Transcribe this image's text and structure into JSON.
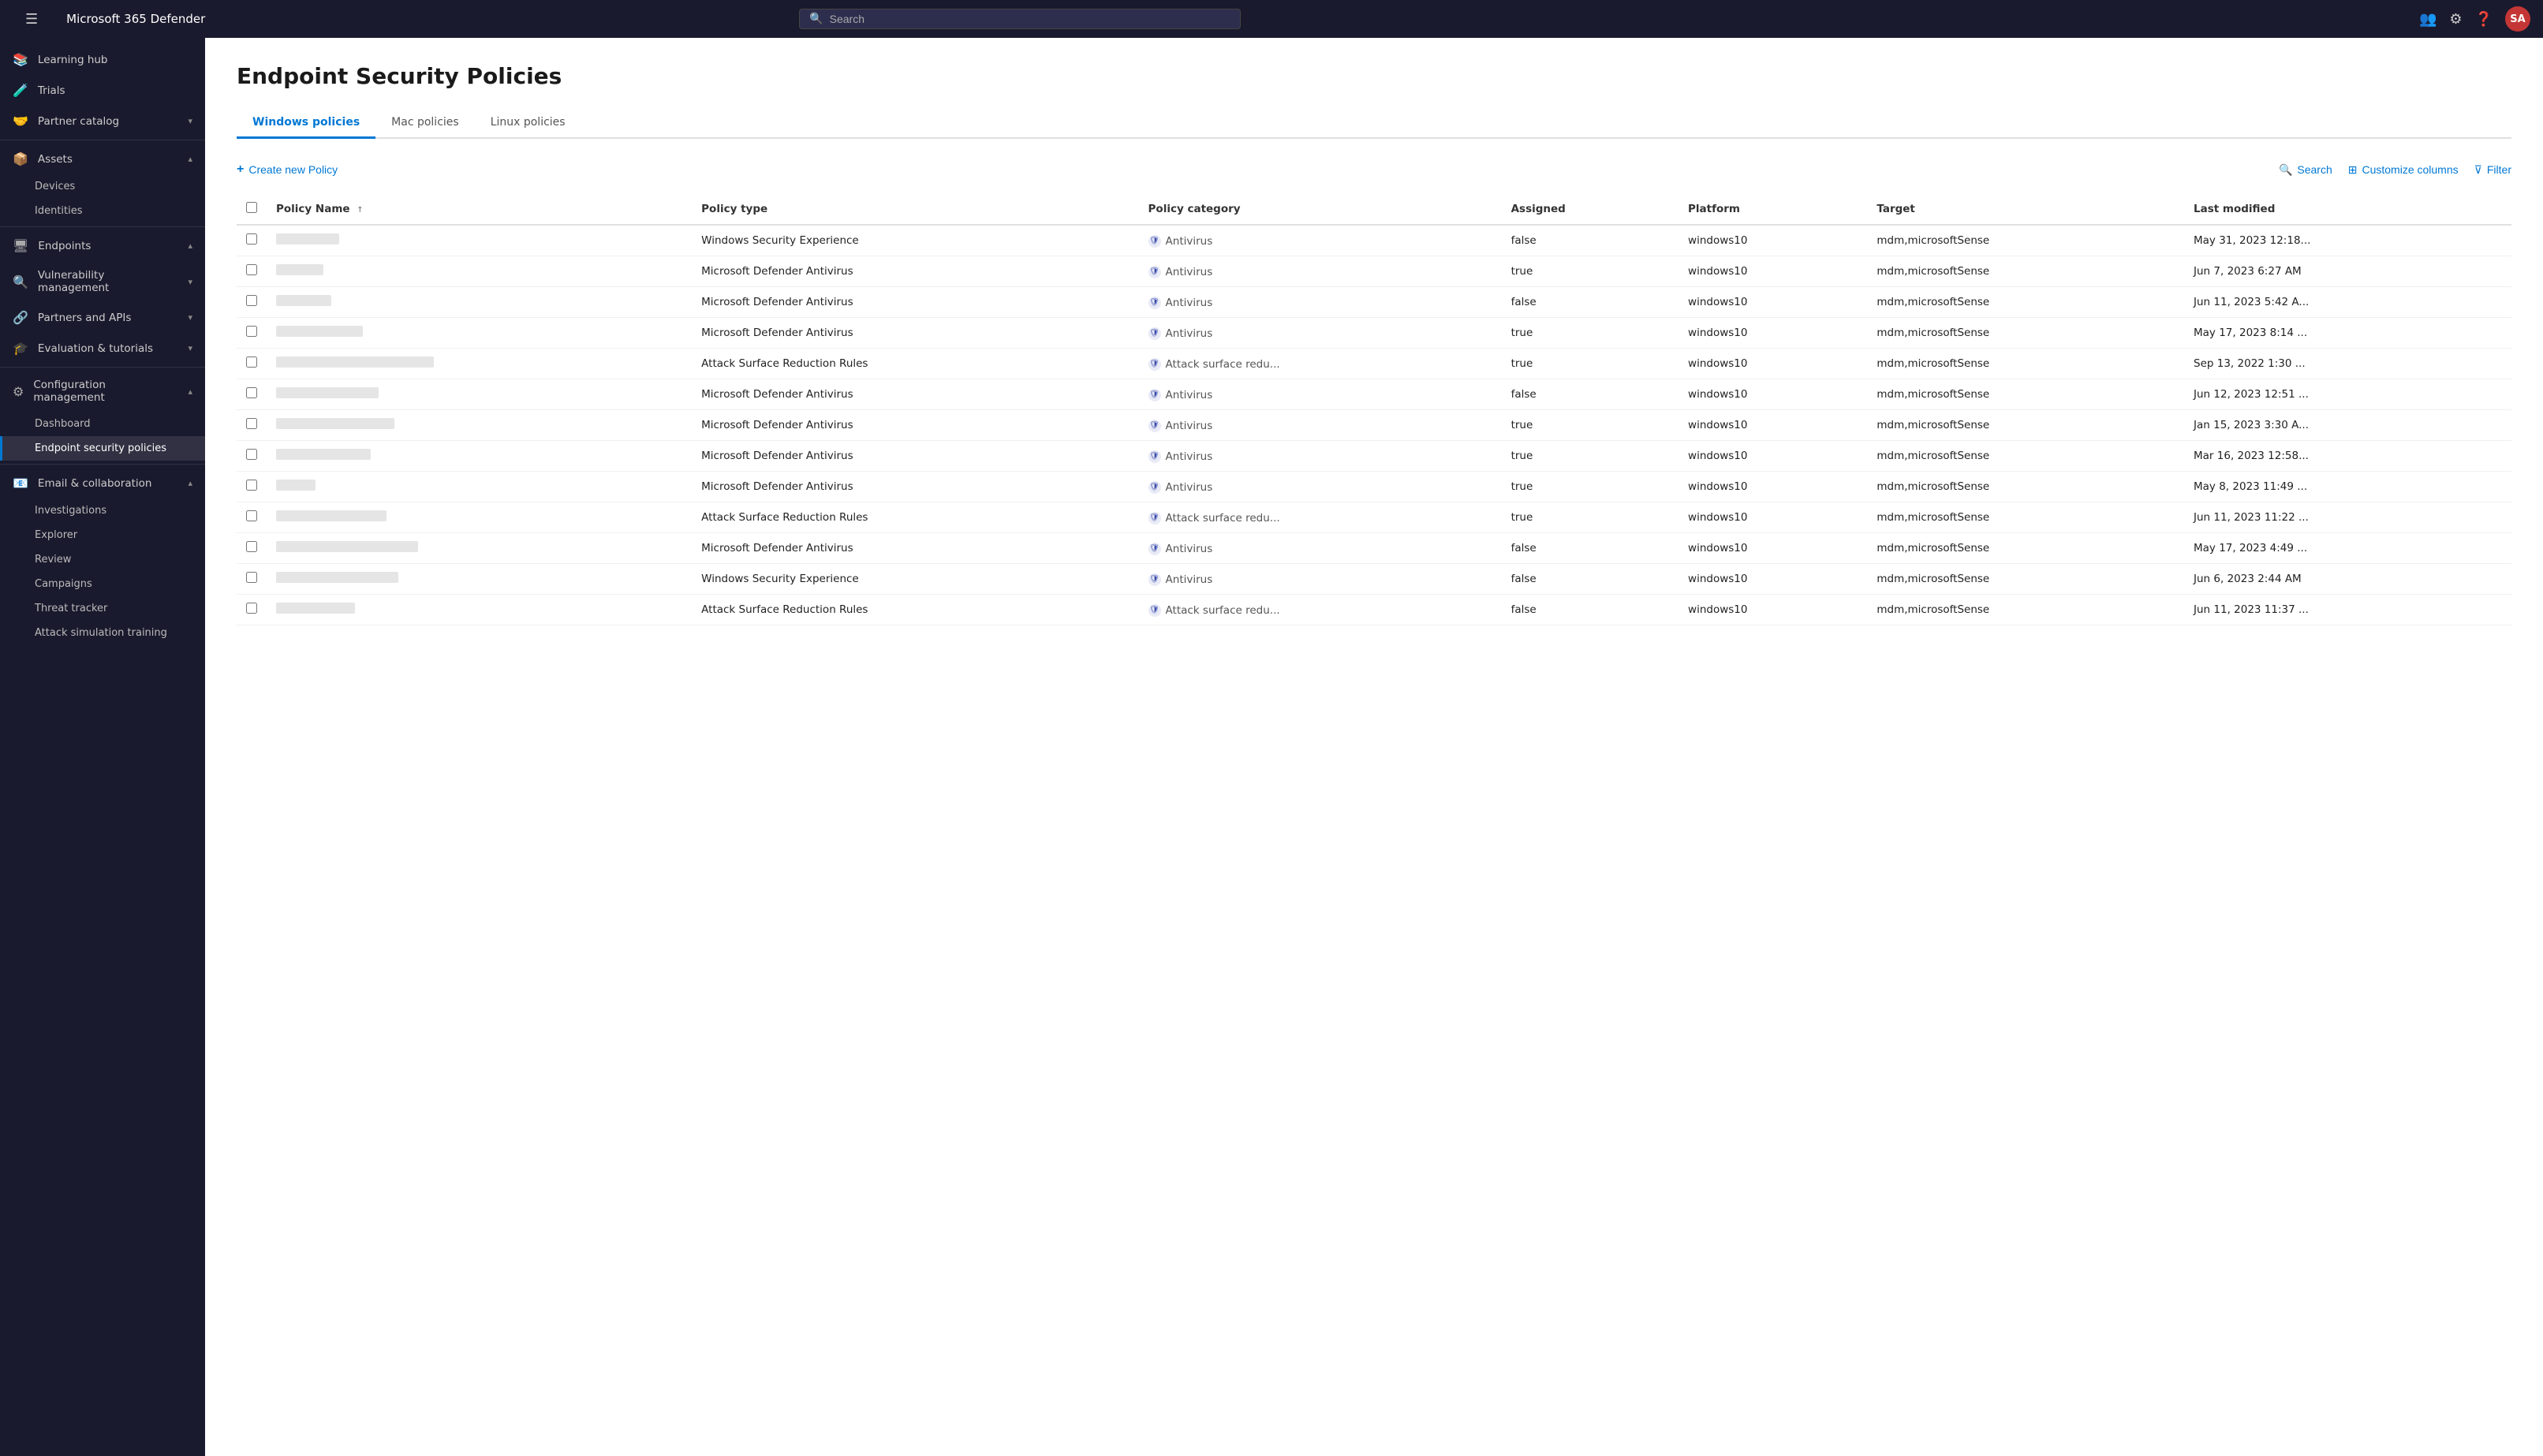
{
  "app": {
    "title": "Microsoft 365 Defender",
    "avatar_initials": "SA"
  },
  "topnav": {
    "search_placeholder": "Search"
  },
  "sidebar": {
    "hamburger_icon": "☰",
    "items": [
      {
        "id": "learning-hub",
        "label": "Learning hub",
        "icon": "📚",
        "expandable": false
      },
      {
        "id": "trials",
        "label": "Trials",
        "icon": "🧪",
        "expandable": false
      },
      {
        "id": "partner-catalog",
        "label": "Partner catalog",
        "icon": "🤝",
        "expandable": true
      },
      {
        "id": "assets",
        "label": "Assets",
        "icon": "📦",
        "expandable": true,
        "expanded": true
      },
      {
        "id": "devices",
        "label": "Devices",
        "icon": "💻",
        "sub": true
      },
      {
        "id": "identities",
        "label": "Identities",
        "icon": "👤",
        "sub": true
      },
      {
        "id": "endpoints",
        "label": "Endpoints",
        "icon": "🖥",
        "expandable": true,
        "expanded": true
      },
      {
        "id": "vulnerability-management",
        "label": "Vulnerability management",
        "icon": "🔍",
        "expandable": true
      },
      {
        "id": "partners-and-apis",
        "label": "Partners and APIs",
        "icon": "🔗",
        "expandable": true
      },
      {
        "id": "evaluation-tutorials",
        "label": "Evaluation & tutorials",
        "icon": "🎓",
        "expandable": true
      },
      {
        "id": "configuration-management",
        "label": "Configuration management",
        "icon": "⚙",
        "expandable": true,
        "expanded": true
      },
      {
        "id": "dashboard",
        "label": "Dashboard",
        "icon": "",
        "sub": true
      },
      {
        "id": "endpoint-security-policies",
        "label": "Endpoint security policies",
        "icon": "",
        "sub": true,
        "active": true
      },
      {
        "id": "email-collaboration",
        "label": "Email & collaboration",
        "icon": "📧",
        "expandable": true,
        "expanded": true
      },
      {
        "id": "investigations",
        "label": "Investigations",
        "icon": "🔬",
        "sub": true
      },
      {
        "id": "explorer",
        "label": "Explorer",
        "icon": "🗂",
        "sub": true
      },
      {
        "id": "review",
        "label": "Review",
        "icon": "👁",
        "sub": true
      },
      {
        "id": "campaigns",
        "label": "Campaigns",
        "icon": "📣",
        "sub": true
      },
      {
        "id": "threat-tracker",
        "label": "Threat tracker",
        "icon": "📍",
        "sub": true
      },
      {
        "id": "attack-simulation",
        "label": "Attack simulation training",
        "icon": "🎯",
        "sub": true
      }
    ]
  },
  "page": {
    "title": "Endpoint Security Policies",
    "tabs": [
      {
        "id": "windows",
        "label": "Windows policies",
        "active": true
      },
      {
        "id": "mac",
        "label": "Mac policies",
        "active": false
      },
      {
        "id": "linux",
        "label": "Linux policies",
        "active": false
      }
    ]
  },
  "toolbar": {
    "create_label": "Create new Policy",
    "search_label": "Search",
    "customize_label": "Customize columns",
    "filter_label": "Filter"
  },
  "table": {
    "columns": [
      {
        "id": "name",
        "label": "Policy Name",
        "sortable": true
      },
      {
        "id": "type",
        "label": "Policy type"
      },
      {
        "id": "category",
        "label": "Policy category"
      },
      {
        "id": "assigned",
        "label": "Assigned"
      },
      {
        "id": "platform",
        "label": "Platform"
      },
      {
        "id": "target",
        "label": "Target"
      },
      {
        "id": "modified",
        "label": "Last modified"
      }
    ],
    "rows": [
      {
        "name_blur": true,
        "name_width": 80,
        "type": "Windows Security Experience",
        "category": "Antivirus",
        "assigned": "false",
        "platform": "windows10",
        "target": "mdm,microsoftSense",
        "modified": "May 31, 2023 12:18..."
      },
      {
        "name_blur": true,
        "name_width": 60,
        "type": "Microsoft Defender Antivirus",
        "category": "Antivirus",
        "assigned": "true",
        "platform": "windows10",
        "target": "mdm,microsoftSense",
        "modified": "Jun 7, 2023 6:27 AM"
      },
      {
        "name_blur": true,
        "name_width": 70,
        "type": "Microsoft Defender Antivirus",
        "category": "Antivirus",
        "assigned": "false",
        "platform": "windows10",
        "target": "mdm,microsoftSense",
        "modified": "Jun 11, 2023 5:42 A..."
      },
      {
        "name_blur": true,
        "name_width": 110,
        "type": "Microsoft Defender Antivirus",
        "category": "Antivirus",
        "assigned": "true",
        "platform": "windows10",
        "target": "mdm,microsoftSense",
        "modified": "May 17, 2023 8:14 ..."
      },
      {
        "name_blur": true,
        "name_width": 200,
        "type": "Attack Surface Reduction Rules",
        "category": "Attack surface redu...",
        "assigned": "true",
        "platform": "windows10",
        "target": "mdm,microsoftSense",
        "modified": "Sep 13, 2022 1:30 ..."
      },
      {
        "name_blur": true,
        "name_width": 130,
        "type": "Microsoft Defender Antivirus",
        "category": "Antivirus",
        "assigned": "false",
        "platform": "windows10",
        "target": "mdm,microsoftSense",
        "modified": "Jun 12, 2023 12:51 ..."
      },
      {
        "name_blur": true,
        "name_width": 150,
        "type": "Microsoft Defender Antivirus",
        "category": "Antivirus",
        "assigned": "true",
        "platform": "windows10",
        "target": "mdm,microsoftSense",
        "modified": "Jan 15, 2023 3:30 A..."
      },
      {
        "name_blur": true,
        "name_width": 120,
        "type": "Microsoft Defender Antivirus",
        "category": "Antivirus",
        "assigned": "true",
        "platform": "windows10",
        "target": "mdm,microsoftSense",
        "modified": "Mar 16, 2023 12:58..."
      },
      {
        "name_blur": true,
        "name_width": 50,
        "type": "Microsoft Defender Antivirus",
        "category": "Antivirus",
        "assigned": "true",
        "platform": "windows10",
        "target": "mdm,microsoftSense",
        "modified": "May 8, 2023 11:49 ..."
      },
      {
        "name_blur": true,
        "name_width": 140,
        "type": "Attack Surface Reduction Rules",
        "category": "Attack surface redu...",
        "assigned": "true",
        "platform": "windows10",
        "target": "mdm,microsoftSense",
        "modified": "Jun 11, 2023 11:22 ..."
      },
      {
        "name_blur": true,
        "name_width": 180,
        "type": "Microsoft Defender Antivirus",
        "category": "Antivirus",
        "assigned": "false",
        "platform": "windows10",
        "target": "mdm,microsoftSense",
        "modified": "May 17, 2023 4:49 ..."
      },
      {
        "name_blur": true,
        "name_width": 155,
        "type": "Windows Security Experience",
        "category": "Antivirus",
        "assigned": "false",
        "platform": "windows10",
        "target": "mdm,microsoftSense",
        "modified": "Jun 6, 2023 2:44 AM"
      },
      {
        "name_blur": true,
        "name_width": 100,
        "type": "Attack Surface Reduction Rules",
        "category": "Attack surface redu...",
        "assigned": "false",
        "platform": "windows10",
        "target": "mdm,microsoftSense",
        "modified": "Jun 11, 2023 11:37 ..."
      }
    ]
  }
}
